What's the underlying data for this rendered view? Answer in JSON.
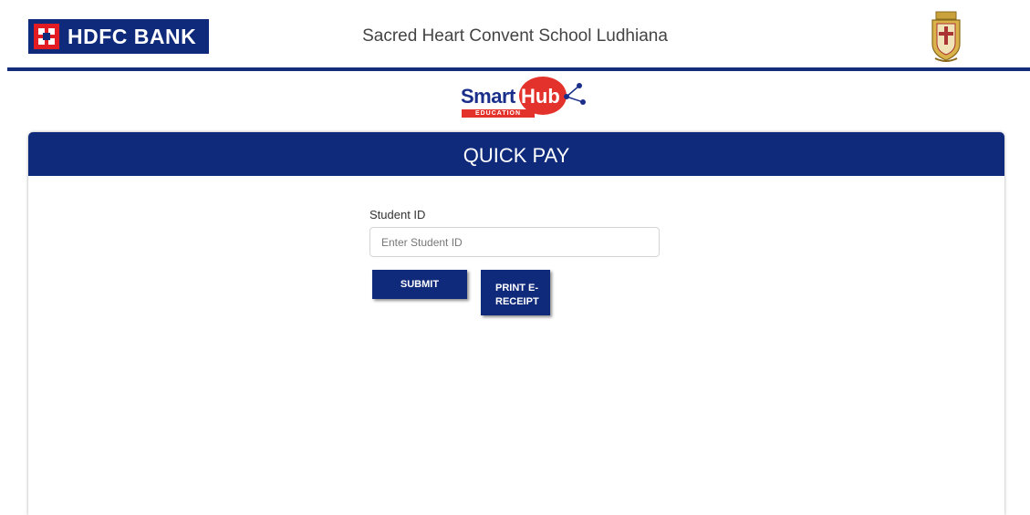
{
  "header": {
    "bank_name": "HDFC BANK",
    "school_name": "Sacred Heart Convent School Ludhiana",
    "school_crest_icon": "school-crest-icon"
  },
  "brand": {
    "smart": "Smart",
    "hub": "Hub",
    "education": "EDUCATION"
  },
  "quick_pay": {
    "title": "QUICK PAY",
    "student_id_label": "Student ID",
    "student_id_placeholder": "Enter Student ID",
    "student_id_value": "",
    "submit_label": "SUBMIT",
    "print_label_line1": "PRINT E-",
    "print_label_line2": "RECEIPT"
  },
  "colors": {
    "brand_navy": "#0f2a7a",
    "brand_red": "#e31b23"
  }
}
